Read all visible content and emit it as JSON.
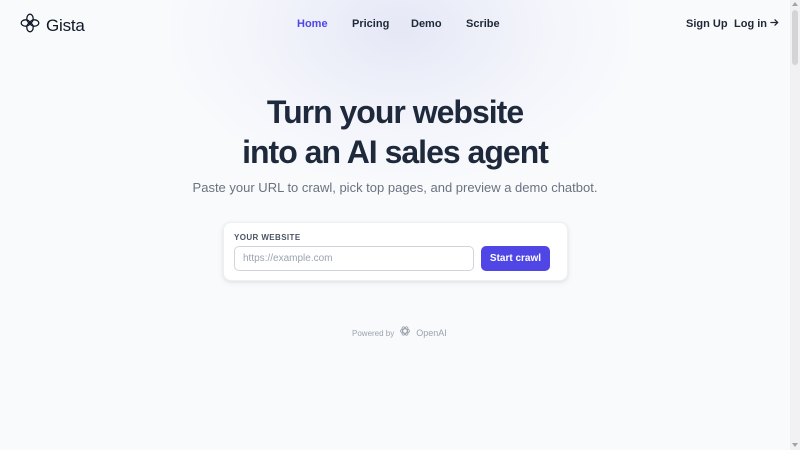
{
  "brand": {
    "name": "Gista",
    "logo_icon": "flower-logo-icon"
  },
  "nav": {
    "links": [
      {
        "label": "Home",
        "active": true
      },
      {
        "label": "Pricing",
        "active": false
      },
      {
        "label": "Demo",
        "active": false
      },
      {
        "label": "Scribe",
        "active": false
      }
    ],
    "signup_label": "Sign Up",
    "login_label": "Log in",
    "login_icon": "arrow-right-icon"
  },
  "hero": {
    "title_line1": "Turn your website",
    "title_line2": "into an AI sales agent",
    "subtitle": "Paste your URL to crawl, pick top pages, and preview a demo chatbot."
  },
  "form": {
    "label": "YOUR WEBSITE",
    "input_value": "",
    "input_placeholder": "https://example.com",
    "button_label": "Start crawl"
  },
  "footer": {
    "powered_by": "Powered by",
    "provider": "OpenAI",
    "provider_icon": "openai-logo-icon"
  },
  "colors": {
    "accent": "#4f46e5",
    "heading": "#1e293b",
    "muted": "#6b7280",
    "background": "#f9fafc"
  }
}
